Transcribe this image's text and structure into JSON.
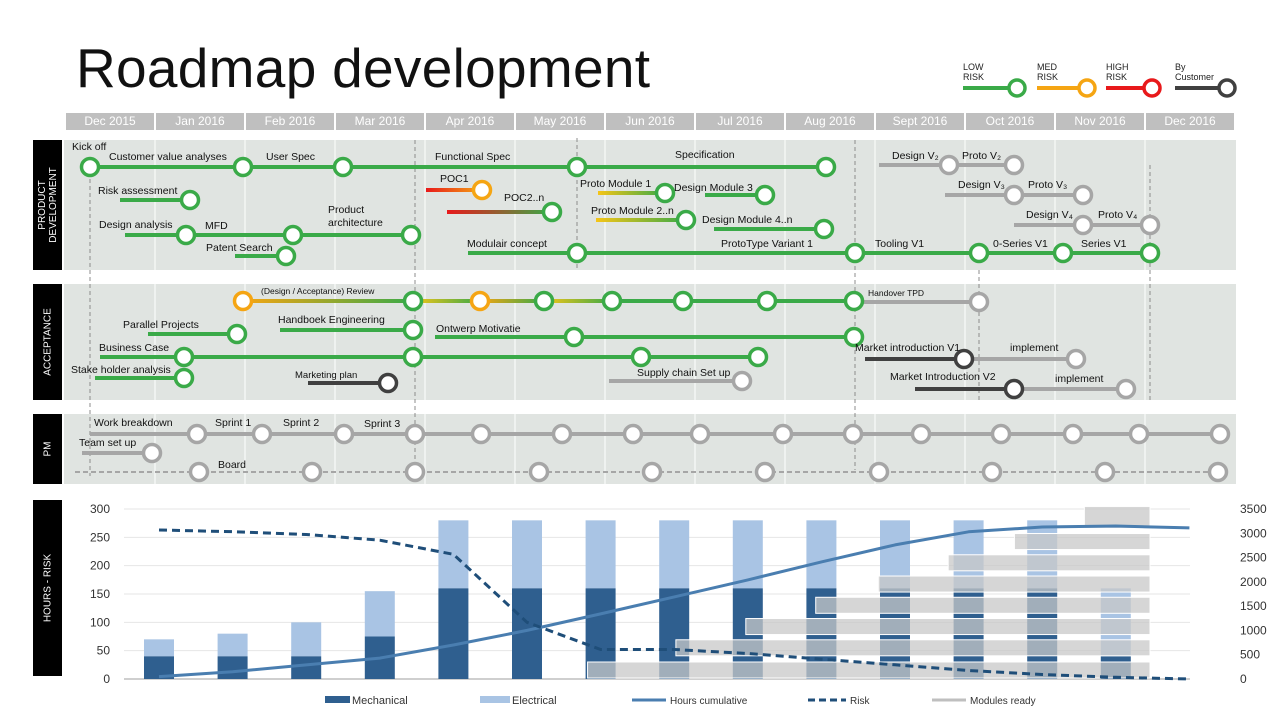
{
  "title": "Roadmap development",
  "legend": [
    {
      "line1": "LOW",
      "line2": "RISK",
      "color": "#3aaa48"
    },
    {
      "line1": "MED",
      "line2": "RISK",
      "color": "#f5a513"
    },
    {
      "line1": "HIGH",
      "line2": "RISK",
      "color": "#e8191b"
    },
    {
      "line1": "By",
      "line2": "Customer",
      "color": "#404040"
    }
  ],
  "months": [
    "Dec 2015",
    "Jan 2016",
    "Feb 2016",
    "Mar 2016",
    "Apr 2016",
    "May 2016",
    "Jun 2016",
    "Jul 2016",
    "Aug 2016",
    "Sept 2016",
    "Oct 2016",
    "Nov 2016",
    "Dec 2016"
  ],
  "sections": {
    "product_development": [
      "PRODUCT",
      "DEVELOPMENT"
    ],
    "acceptance": "ACCEPTANCE",
    "pm": "PM",
    "hours_risk": "HOURS - RISK"
  },
  "product_development_labels": [
    "Kick off",
    "Customer value analyses",
    "User Spec",
    "Functional Spec",
    "Specification",
    "Risk assessment",
    "Design analysis",
    "MFD",
    "Product",
    "architecture",
    "Patent Search",
    "POC1",
    "POC2..n",
    "Proto Module 1",
    "Design Module 3",
    "Proto Module 2..n",
    "Design Module 4..n",
    "Modulair concept",
    "ProtoType Variant 1",
    "Tooling V1",
    "0-Series V1",
    "Series V1",
    "Design V₂",
    "Proto V₂",
    "Design V₃",
    "Proto V₃",
    "Design V₄",
    "Proto V₄"
  ],
  "acceptance_labels": [
    "(Design / Acceptance) Review",
    "Handover TPD",
    "Parallel Projects",
    "Handboek Engineering",
    "Ontwerp Motivatie",
    "Business Case",
    "Stake holder analysis",
    "Marketing plan",
    "Supply chain Set up",
    "Market introduction V1",
    "implement",
    "Market Introduction V2",
    "implement"
  ],
  "pm_labels": [
    "Work breakdown",
    "Sprint 1",
    "Sprint 2",
    "Sprint 3",
    "Team set up",
    "Board"
  ],
  "chart_data": {
    "type": "bar",
    "categories_count": 14,
    "ylim_left": [
      0,
      300
    ],
    "ylim_right": [
      0,
      3500
    ],
    "left_ticks": [
      0,
      50,
      100,
      150,
      200,
      250,
      300
    ],
    "right_ticks": [
      0,
      500,
      1000,
      1500,
      2000,
      2500,
      3000,
      3500
    ],
    "series": [
      {
        "name": "Mechanical",
        "type": "bar",
        "axis": "left",
        "color": "#2f5f8f",
        "values": [
          40,
          40,
          40,
          75,
          160,
          160,
          160,
          160,
          160,
          160,
          160,
          160,
          160,
          40
        ]
      },
      {
        "name": "Electrical",
        "type": "bar",
        "axis": "left",
        "color": "#a9c4e4",
        "values": [
          30,
          40,
          60,
          80,
          120,
          120,
          120,
          120,
          120,
          120,
          120,
          120,
          120,
          120
        ]
      },
      {
        "name": "Hours cumulative",
        "type": "line",
        "axis": "right",
        "color": "#4a7eb0",
        "values": [
          50,
          150,
          290,
          430,
          700,
          1000,
          1340,
          1690,
          2040,
          2410,
          2760,
          3030,
          3130,
          3150,
          3110
        ]
      },
      {
        "name": "Risk",
        "type": "line-dashed",
        "axis": "left",
        "color": "#1f4e79",
        "values": [
          263,
          260,
          255,
          245,
          220,
          100,
          52,
          52,
          45,
          35,
          25,
          15,
          8,
          3,
          0
        ]
      },
      {
        "name": "Modules ready",
        "type": "bands",
        "axis": "right",
        "color": "#c8c8c8",
        "start_category": [
          6.85,
          8.05,
          9.0,
          9.95,
          10.8,
          11.75,
          12.65,
          13.6
        ]
      }
    ],
    "grid": true,
    "legend": "bottom"
  }
}
